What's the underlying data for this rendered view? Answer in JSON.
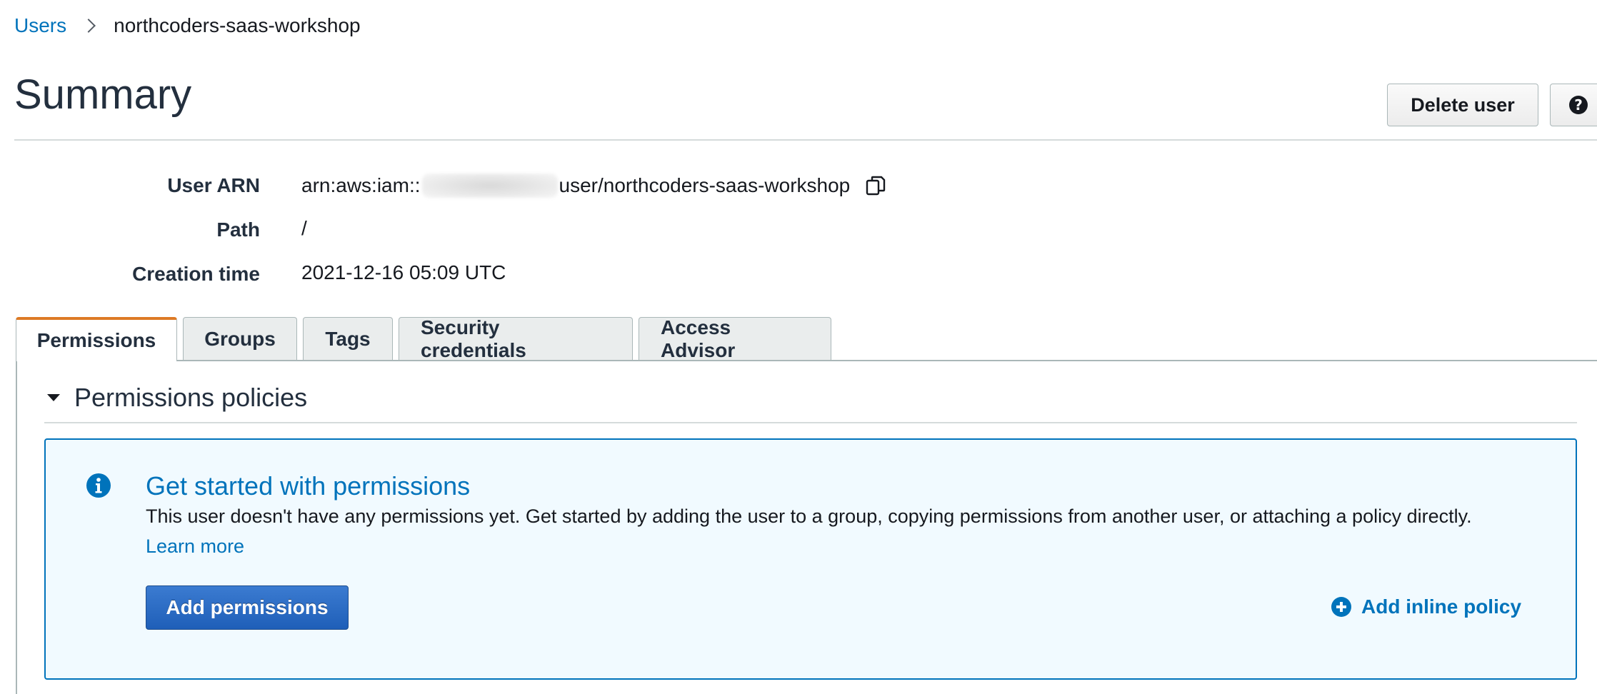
{
  "breadcrumb": {
    "parent": "Users",
    "current": "northcoders-saas-workshop"
  },
  "header": {
    "title": "Summary",
    "delete_label": "Delete user",
    "help_label": "?"
  },
  "details": {
    "arn_label": "User ARN",
    "arn_prefix": "arn:aws:iam::",
    "arn_suffix": "user/northcoders-saas-workshop",
    "path_label": "Path",
    "path_value": "/",
    "creation_label": "Creation time",
    "creation_value": "2021-12-16 05:09 UTC"
  },
  "tabs": [
    {
      "label": "Permissions",
      "active": true
    },
    {
      "label": "Groups"
    },
    {
      "label": "Tags"
    },
    {
      "label": "Security credentials"
    },
    {
      "label": "Access Advisor"
    }
  ],
  "section": {
    "title": "Permissions policies"
  },
  "info": {
    "title": "Get started with permissions",
    "text": "This user doesn't have any permissions yet. Get started by adding the user to a group, copying permissions from another user, or attaching a policy directly.",
    "link": "Learn more",
    "add_button": "Add permissions",
    "inline_link": "Add inline policy"
  },
  "colors": {
    "link": "#0073bb",
    "active_tab_accent": "#dd7a25",
    "primary_button": "#1f5fb8",
    "info_background": "#f1faff"
  },
  "icons": [
    "chevron-right-icon",
    "help-icon",
    "copy-icon",
    "caret-down-icon",
    "info-icon",
    "plus-circle-icon"
  ]
}
